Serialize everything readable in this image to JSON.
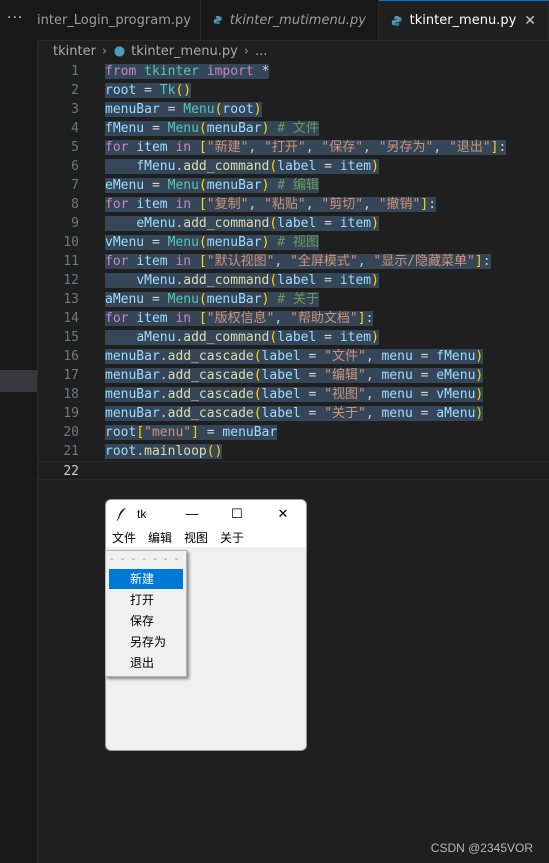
{
  "tabs": [
    {
      "label": "inter_Login_program.py",
      "active": false
    },
    {
      "label": "tkinter_mutimenu.py",
      "active": false
    },
    {
      "label": "tkinter_menu.py",
      "active": true
    }
  ],
  "breadcrumb": {
    "folder": "tkinter",
    "file": "tkinter_menu.py",
    "more": "..."
  },
  "editor": {
    "line_numbers": [
      "1",
      "2",
      "3",
      "4",
      "5",
      "6",
      "7",
      "8",
      "9",
      "10",
      "11",
      "12",
      "13",
      "14",
      "15",
      "16",
      "17",
      "18",
      "19",
      "20",
      "21",
      "22"
    ],
    "current_line": "22"
  },
  "tk_window": {
    "title": "tk",
    "minimize": "—",
    "maximize": "☐",
    "close": "✕",
    "menubar": [
      "文件",
      "编辑",
      "视图",
      "关于"
    ],
    "tearoff": "- - - - - - - -",
    "dropdown": [
      "新建",
      "打开",
      "保存",
      "另存为",
      "退出"
    ],
    "selected_item": "新建"
  },
  "sidebar": {
    "more": "···"
  },
  "watermark": "CSDN @2345VOR",
  "colors": {
    "accent": "#0078d4",
    "selection": "#0078d7"
  }
}
